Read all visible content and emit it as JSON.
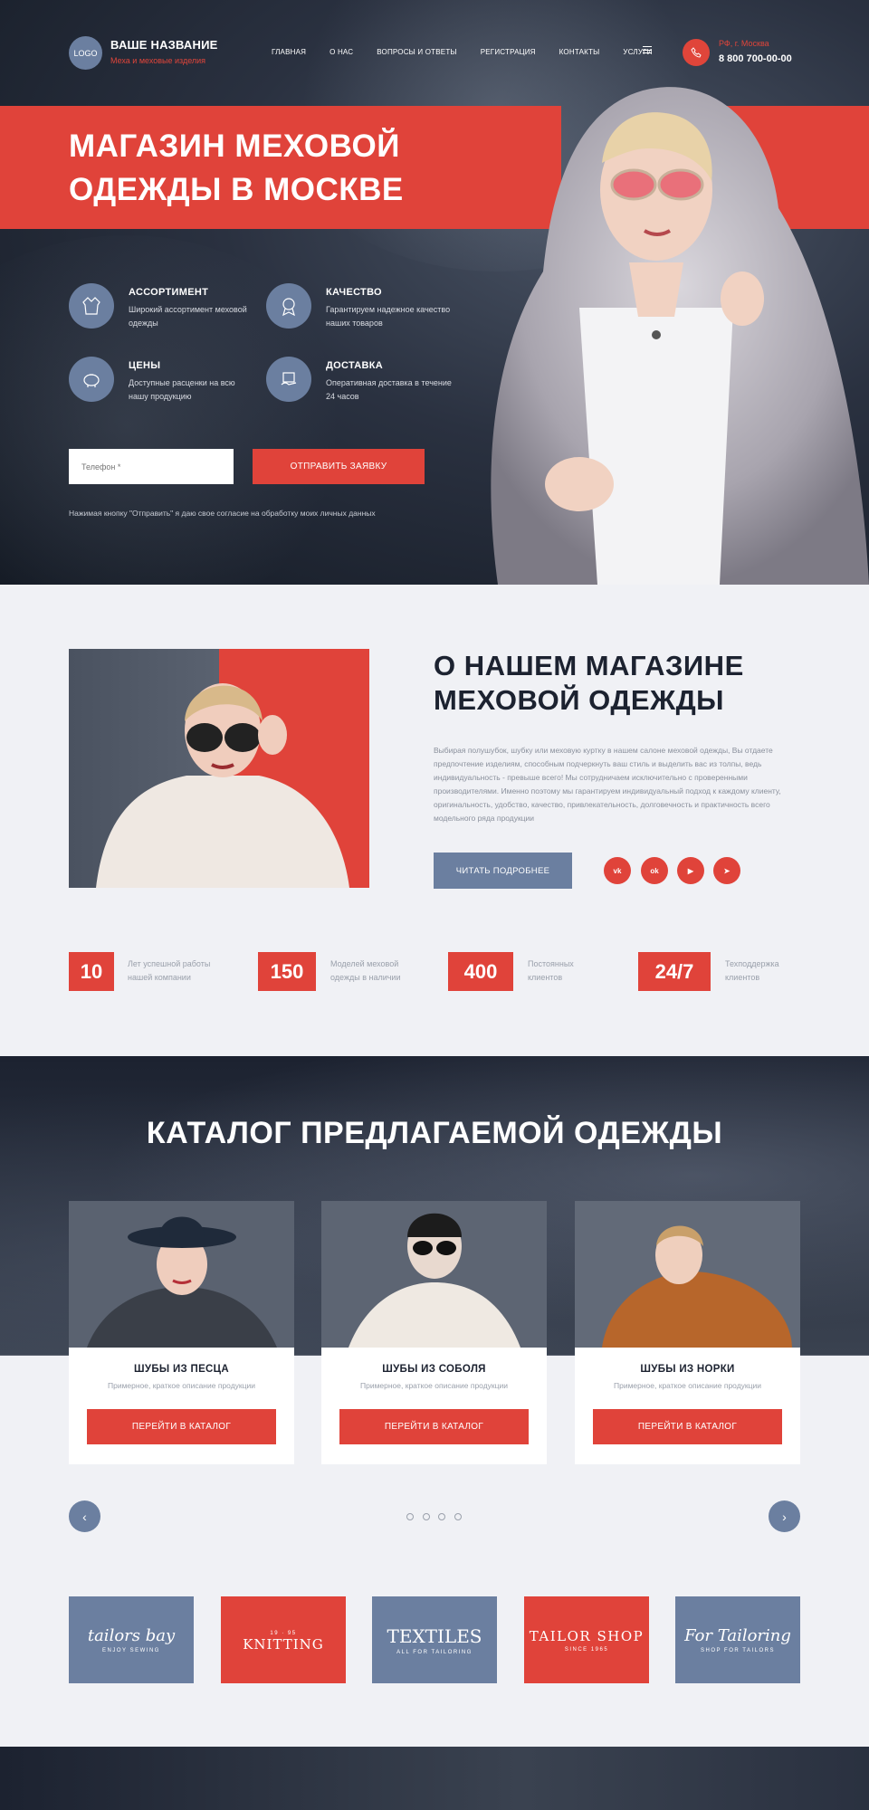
{
  "header": {
    "logo": "LOGO",
    "brand_name": "ВАШЕ НАЗВАНИЕ",
    "brand_sub": "Меха и меховые изделия",
    "nav": [
      "ГЛАВНАЯ",
      "О НАС",
      "ВОПРОСЫ И ОТВЕТЫ",
      "РЕГИСТРАЦИЯ",
      "КОНТАКТЫ",
      "УСЛУГИ"
    ],
    "menu_icon": "hamburger-icon",
    "phone_icon": "phone-icon",
    "city": "РФ, г. Москва",
    "phone": "8 800 700-00-00"
  },
  "hero": {
    "title": "МАГАЗИН МЕХОВОЙ\nОДЕЖДЫ В МОСКВЕ",
    "features": [
      {
        "icon": "coat-icon",
        "title": "АССОРТИМЕНТ",
        "desc": "Широкий ассортимент меховой одежды"
      },
      {
        "icon": "medal-icon",
        "title": "КАЧЕСТВО",
        "desc": "Гарантируем надежное качество наших товаров"
      },
      {
        "icon": "piggy-bank-icon",
        "title": "ЦЕНЫ",
        "desc": "Доступные расценки на всю нашу продукцию"
      },
      {
        "icon": "delivery-icon",
        "title": "ДОСТАВКА",
        "desc": "Оперативная доставка в течение 24 часов"
      }
    ],
    "phone_placeholder": "Телефон *",
    "submit": "ОТПРАВИТЬ ЗАЯВКУ",
    "consent": "Нажимая кнопку \"Отправить\" я даю свое согласие на обработку моих личных данных"
  },
  "about": {
    "title": "О НАШЕМ МАГАЗИНЕ\nМЕХОВОЙ ОДЕЖДЫ",
    "text": "Выбирая полушубок, шубку или меховую куртку в нашем салоне меховой одежды, Вы отдаете предпочтение изделиям, способным подчеркнуть ваш стиль и выделить вас из толпы, ведь индивидуальность - превыше всего! Мы сотрудничаем исключительно с проверенными производителями. Именно поэтому мы гарантируем индивидуальный подход к каждому клиенту, оригинальность, удобство, качество, привлекательность, долговечность и практичность всего модельного ряда продукции",
    "more": "ЧИТАТЬ ПОДРОБНЕЕ",
    "socials": [
      "vk",
      "ok",
      "youtube",
      "telegram"
    ],
    "social_labels": [
      "vk",
      "ok",
      "▶",
      "➤"
    ]
  },
  "stats": [
    {
      "value": "10",
      "label": "Лет успешной работы нашей компании"
    },
    {
      "value": "150",
      "label": "Моделей меховой одежды в наличии"
    },
    {
      "value": "400",
      "label": "Постоянных клиентов"
    },
    {
      "value": "24/7",
      "label": "Техподдержка клиентов"
    }
  ],
  "catalog": {
    "title": "КАТАЛОГ ПРЕДЛАГАЕМОЙ ОДЕЖДЫ",
    "cards": [
      {
        "title": "ШУБЫ ИЗ ПЕСЦА",
        "desc": "Примерное, краткое описание продукции",
        "button": "ПЕРЕЙТИ В КАТАЛОГ"
      },
      {
        "title": "ШУБЫ ИЗ СОБОЛЯ",
        "desc": "Примерное, краткое описание продукции",
        "button": "ПЕРЕЙТИ В КАТАЛОГ"
      },
      {
        "title": "ШУБЫ ИЗ НОРКИ",
        "desc": "Примерное, краткое описание продукции",
        "button": "ПЕРЕЙТИ В КАТАЛОГ"
      }
    ],
    "prev": "‹",
    "next": "›"
  },
  "partners": [
    {
      "name": "tailors bay",
      "sub": "ENJOY SEWING",
      "color": "#6b7fa0"
    },
    {
      "name": "KNITTING",
      "sub": "19 · 95",
      "color": "#e0433a"
    },
    {
      "name": "TEXTILES",
      "sub": "ALL FOR TAILORING",
      "color": "#6b7fa0"
    },
    {
      "name": "TAILOR SHOP",
      "sub": "SINCE 1965",
      "color": "#e0433a"
    },
    {
      "name": "For Tailoring",
      "sub": "SHOP FOR TAILORS",
      "color": "#6b7fa0"
    }
  ],
  "colors": {
    "accent": "#e0433a",
    "steel": "#6b7fa0",
    "dark": "#1c2230"
  }
}
